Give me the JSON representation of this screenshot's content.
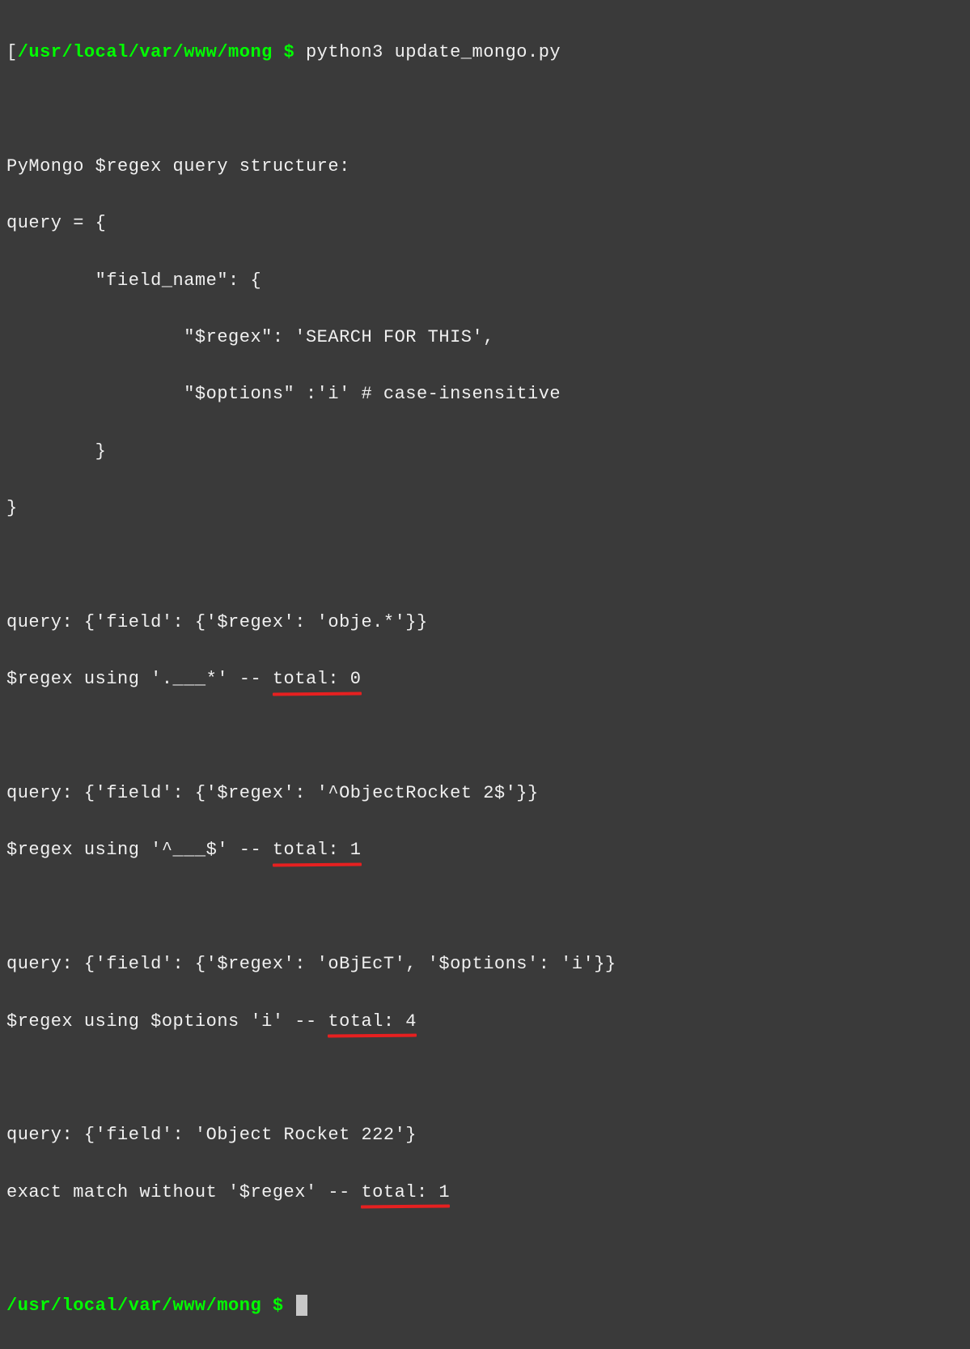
{
  "prompt1": {
    "bracket": "[",
    "path": "/usr/local/var/www/mong",
    "sym": " $ ",
    "command": "python3 update_mongo.py"
  },
  "output": {
    "header": "PyMongo $regex query structure:",
    "struct1": "query = {",
    "struct2": "        \"field_name\": {",
    "struct3": "                \"$regex\": 'SEARCH FOR THIS',",
    "struct4": "                \"$options\" :'i' # case-insensitive",
    "struct5": "        }",
    "struct6": "}",
    "q1_line": "query: {'field': {'$regex': 'obje.*'}}",
    "q1_prefix": "$regex using '.___*' -- ",
    "q1_hl": "total: 0",
    "q2_line": "query: {'field': {'$regex': '^ObjectRocket 2$'}}",
    "q2_prefix": "$regex using '^___$' -- ",
    "q2_hl": "total: 1",
    "q3_line": "query: {'field': {'$regex': 'oBjEcT', '$options': 'i'}}",
    "q3_prefix": "$regex using $options 'i' -- ",
    "q3_hl": "total: 4",
    "q4_line": "query: {'field': 'Object Rocket 222'}",
    "q4_prefix": "exact match without '$regex' -- ",
    "q4_hl": "total: 1"
  },
  "prompt2": {
    "path": "/usr/local/var/www/mong",
    "sym": " $ "
  }
}
